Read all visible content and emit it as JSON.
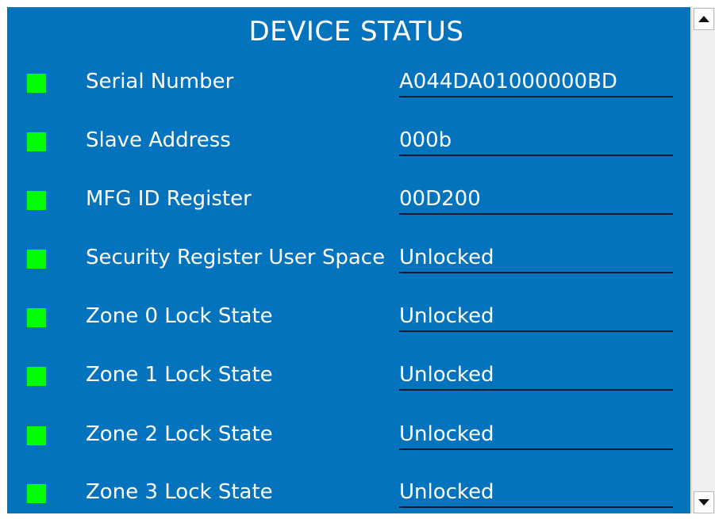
{
  "panel": {
    "title": "DEVICE STATUS",
    "background_color": "#0473bd",
    "indicator_color": "#00ff00",
    "rows": [
      {
        "label": "Serial Number",
        "value": "A044DA01000000BD",
        "indicator": "green-status-icon"
      },
      {
        "label": "Slave Address",
        "value": "000b",
        "indicator": "green-status-icon"
      },
      {
        "label": "MFG ID Register",
        "value": "00D200",
        "indicator": "green-status-icon"
      },
      {
        "label": "Security Register User Space",
        "value": "Unlocked",
        "indicator": "green-status-icon"
      },
      {
        "label": "Zone 0 Lock State",
        "value": "Unlocked",
        "indicator": "green-status-icon"
      },
      {
        "label": "Zone 1 Lock State",
        "value": "Unlocked",
        "indicator": "green-status-icon"
      },
      {
        "label": "Zone 2 Lock State",
        "value": "Unlocked",
        "indicator": "green-status-icon"
      },
      {
        "label": "Zone 3 Lock State",
        "value": "Unlocked",
        "indicator": "green-status-icon"
      }
    ]
  },
  "scrollbar": {
    "up_icon": "chevron-up-icon",
    "down_icon": "chevron-down-icon"
  }
}
